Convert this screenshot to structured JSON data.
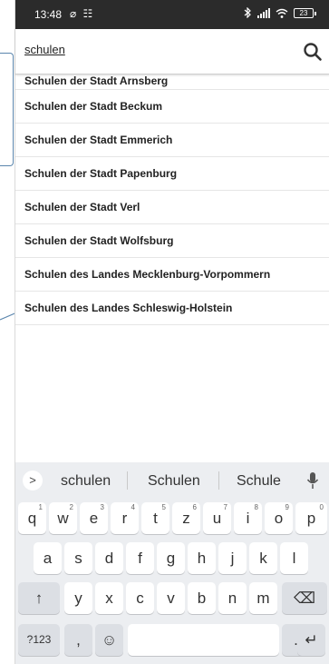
{
  "status_bar": {
    "time": "13:48",
    "left_icons": "⌀ ☷",
    "battery": "23"
  },
  "search": {
    "query": "schulen"
  },
  "results": [
    "Schulen der Stadt Arnsberg",
    "Schulen der Stadt Beckum",
    "Schulen der Stadt Emmerich",
    "Schulen der Stadt Papenburg",
    "Schulen der Stadt Verl",
    "Schulen der Stadt Wolfsburg",
    "Schulen des Landes Mecklenburg-Vorpommern",
    "Schulen des Landes Schleswig-Holstein"
  ],
  "keyboard": {
    "expand_symbol": ">",
    "suggestions": [
      "schulen",
      "Schulen",
      "Schule"
    ],
    "row1": [
      {
        "key": "q",
        "hint": "1"
      },
      {
        "key": "w",
        "hint": "2"
      },
      {
        "key": "e",
        "hint": "3"
      },
      {
        "key": "r",
        "hint": "4"
      },
      {
        "key": "t",
        "hint": "5"
      },
      {
        "key": "z",
        "hint": "6"
      },
      {
        "key": "u",
        "hint": "7"
      },
      {
        "key": "i",
        "hint": "8"
      },
      {
        "key": "o",
        "hint": "9"
      },
      {
        "key": "p",
        "hint": "0"
      }
    ],
    "row2": [
      "a",
      "s",
      "d",
      "f",
      "g",
      "h",
      "j",
      "k",
      "l"
    ],
    "row3": [
      "y",
      "x",
      "c",
      "v",
      "b",
      "n",
      "m"
    ],
    "shift_symbol": "↑",
    "backspace_symbol": "⌫",
    "symbols_label": "?123",
    "comma": ",",
    "emoji_symbol": "☺",
    "period": ".",
    "enter_symbol": "↵"
  }
}
